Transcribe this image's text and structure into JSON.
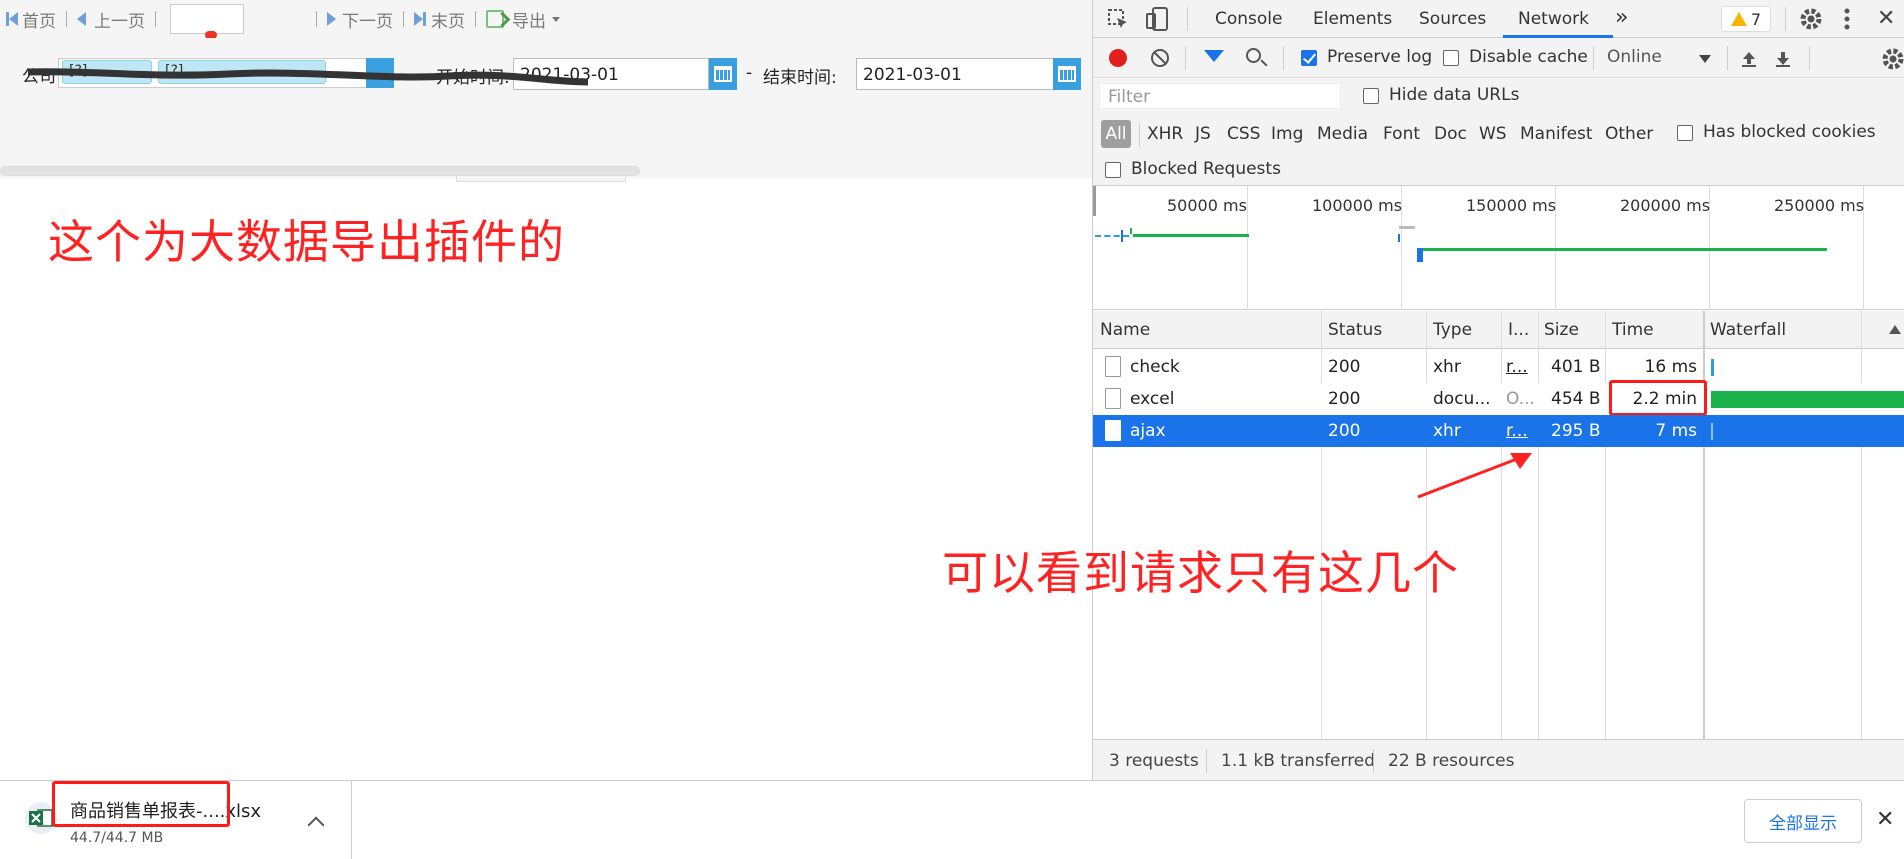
{
  "pager": {
    "first": "首页",
    "prev": "上一页",
    "next": "下一页",
    "last": "末页",
    "export": "导出"
  },
  "filters": {
    "company_label": "公司",
    "company_tags": [
      "[?]",
      "[?]"
    ],
    "start_label": "开始时间:",
    "start_value": "2021-03-01",
    "dash": "-",
    "end_label": "结束时间:",
    "end_value": "2021-03-01"
  },
  "annotations": {
    "plugin_note": "这个为大数据导出插件的",
    "requests_note": "可以看到请求只有这几个"
  },
  "devtools": {
    "tabs": [
      "Console",
      "Elements",
      "Sources",
      "Network"
    ],
    "active_tab": "Network",
    "more_tabs": "»",
    "warning_count": "7",
    "toolbar": {
      "preserve_log": "Preserve log",
      "preserve_log_checked": true,
      "disable_cache": "Disable cache",
      "disable_cache_checked": false,
      "throttling": "Online"
    },
    "filter_placeholder": "Filter",
    "hide_data_urls": "Hide data URLs",
    "types": [
      "All",
      "XHR",
      "JS",
      "CSS",
      "Img",
      "Media",
      "Font",
      "Doc",
      "WS",
      "Manifest",
      "Other"
    ],
    "has_blocked_cookies": "Has blocked cookies",
    "blocked_requests": "Blocked Requests",
    "overview_ticks": [
      "50000 ms",
      "100000 ms",
      "150000 ms",
      "200000 ms",
      "250000 ms"
    ],
    "columns": [
      "Name",
      "Status",
      "Type",
      "I...",
      "Size",
      "Time",
      "Waterfall"
    ],
    "rows": [
      {
        "name": "check",
        "status": "200",
        "type": "xhr",
        "initiator": "r...",
        "size": "401 B",
        "time": "16 ms",
        "selected": false
      },
      {
        "name": "excel",
        "status": "200",
        "type": "docu...",
        "initiator": "O...",
        "size": "454 B",
        "time": "2.2 min",
        "selected": false
      },
      {
        "name": "ajax",
        "status": "200",
        "type": "xhr",
        "initiator": "r...",
        "size": "295 B",
        "time": "7 ms",
        "selected": true
      }
    ],
    "status_bar": {
      "requests": "3 requests",
      "transferred": "1.1 kB transferred",
      "resources": "22 B resources"
    },
    "colors": {
      "accent": "#1a73e8",
      "record": "#e0201a",
      "waterfall_green": "#1ab34a"
    }
  },
  "download": {
    "file_name": "商品销售单报表-....xlsx",
    "progress": "44.7/44.7 MB",
    "show_all": "全部显示",
    "close": "✕"
  }
}
